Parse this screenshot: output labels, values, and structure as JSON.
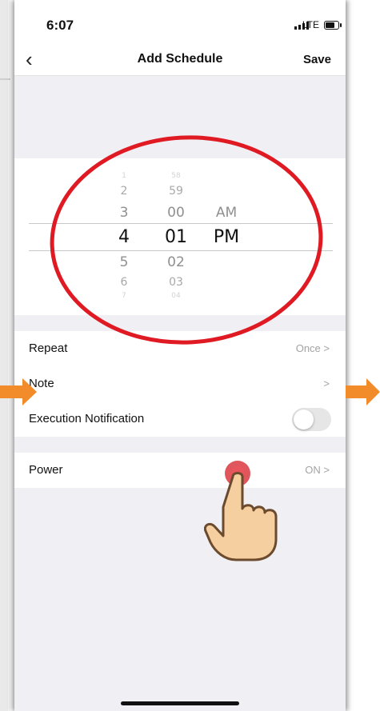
{
  "status_bar": {
    "time": "6:07",
    "network": "LTE"
  },
  "navbar": {
    "back_label": "‹",
    "title": "Add Schedule",
    "save_label": "Save"
  },
  "time_picker": {
    "hours": [
      "1",
      "2",
      "3",
      "4",
      "5",
      "6",
      "7"
    ],
    "minutes": [
      "58",
      "59",
      "00",
      "01",
      "02",
      "03",
      "04"
    ],
    "periods": [
      "AM",
      "PM"
    ],
    "selected": {
      "hour": "4",
      "minute": "01",
      "period": "PM"
    }
  },
  "settings": {
    "repeat": {
      "label": "Repeat",
      "value": "Once",
      "chevron": ">"
    },
    "note": {
      "label": "Note",
      "chevron": ">"
    },
    "execution_notification": {
      "label": "Execution Notification",
      "enabled": false
    },
    "power": {
      "label": "Power",
      "value": "ON",
      "chevron": ">"
    }
  },
  "annotations": {
    "highlight_color": "#e01a22",
    "arrow_color": "#f28c2b",
    "tap_dot_color": "#d9383f"
  }
}
